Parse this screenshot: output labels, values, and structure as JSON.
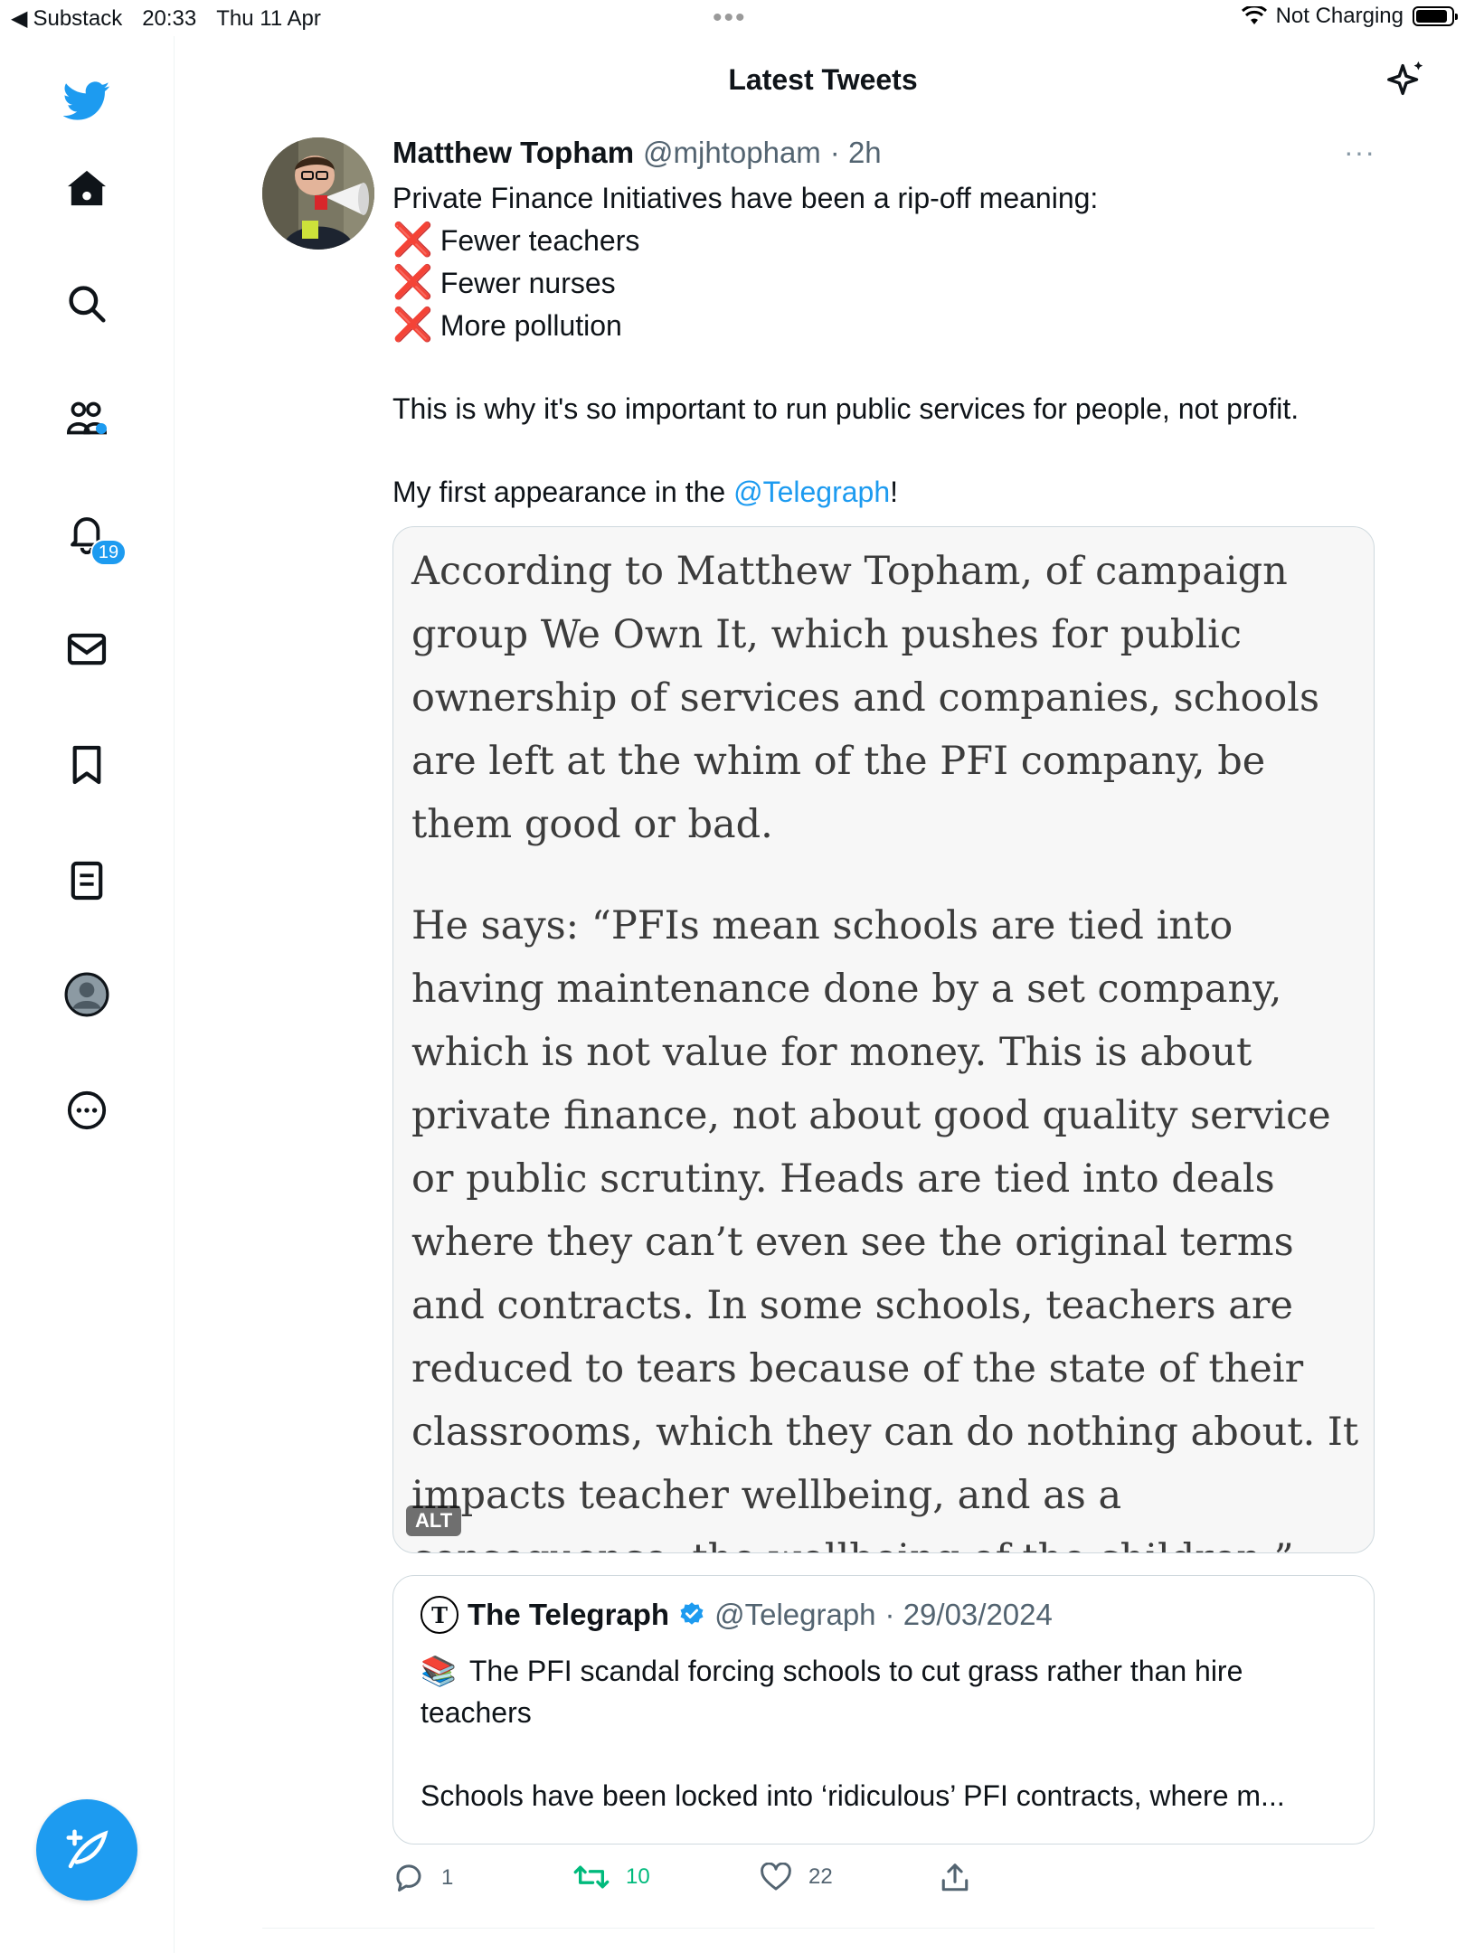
{
  "status_bar": {
    "back_app": "Substack",
    "time": "20:33",
    "date": "Thu 11 Apr",
    "charging": "Not Charging"
  },
  "header": {
    "title": "Latest Tweets"
  },
  "sidebar": {
    "items": [
      {
        "name": "home"
      },
      {
        "name": "search"
      },
      {
        "name": "communities"
      },
      {
        "name": "notifications",
        "badge": "19"
      },
      {
        "name": "messages"
      },
      {
        "name": "bookmarks"
      },
      {
        "name": "lists"
      },
      {
        "name": "profile"
      },
      {
        "name": "more"
      }
    ]
  },
  "tweet": {
    "author_name": "Matthew Topham",
    "handle": "@mjhtopham",
    "time": "· 2h",
    "more": "···",
    "intro": "Private Finance Initiatives have been a rip-off meaning:",
    "bullet_mark": "❌",
    "bullets": [
      "Fewer teachers",
      "Fewer nurses",
      "More pollution"
    ],
    "para": "This is why it's so important to run public services for people, not profit.",
    "appearance_prefix": "My first appearance in the ",
    "mention": "@Telegraph",
    "appearance_suffix": "!",
    "image": {
      "para1": "According to Matthew Topham, of campaign group We Own It, which pushes for public ownership of services and companies, schools are left at the whim of the PFI company, be them good or bad.",
      "para2": "He says: “PFIs mean schools are tied into having maintenance done by a set company, which is not value for money. This is about private finance, not about good quality service or public scrutiny. Heads are tied into deals where they can’t even see the original terms and contracts. In some schools, teachers are reduced to tears because of the state of their classrooms, which they can do nothing about. It impacts teacher wellbeing, and as a consequence, the wellbeing of the children.”",
      "alt_label": "ALT"
    },
    "quoted": {
      "name": "The Telegraph",
      "handle": "@Telegraph",
      "date": "· 29/03/2024",
      "emoji": "📚",
      "line1": "The PFI scandal forcing schools to cut grass rather than hire teachers",
      "line2": "Schools have been locked into ‘ridiculous’ PFI contracts, where m..."
    },
    "actions": {
      "replies": "1",
      "retweets": "10",
      "likes": "22"
    }
  },
  "colors": {
    "accent": "#1d9bf0",
    "retweet": "#00ba7c",
    "muted": "#536471"
  }
}
